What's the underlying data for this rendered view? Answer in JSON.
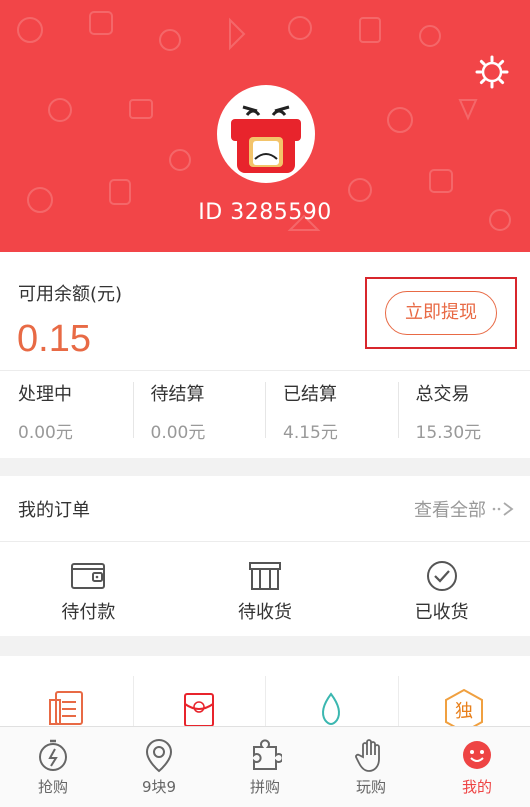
{
  "header": {
    "user_id": "ID 3285590"
  },
  "balance": {
    "label": "可用余额(元)",
    "value": "0.15",
    "withdraw_label": "立即提现"
  },
  "stats": [
    {
      "label": "处理中",
      "value": "0.00元"
    },
    {
      "label": "待结算",
      "value": "0.00元"
    },
    {
      "label": "已结算",
      "value": "4.15元"
    },
    {
      "label": "总交易",
      "value": "15.30元"
    }
  ],
  "orders": {
    "title": "我的订单",
    "view_all": "查看全部",
    "items": [
      {
        "label": "待付款",
        "icon": "wallet-icon"
      },
      {
        "label": "待收货",
        "icon": "package-icon"
      },
      {
        "label": "已收货",
        "icon": "check-circle-icon"
      }
    ]
  },
  "tools": [
    {
      "icon": "document-list-icon"
    },
    {
      "icon": "red-envelope-icon"
    },
    {
      "icon": "teardrop-icon"
    },
    {
      "icon": "exclusive-badge-icon",
      "text": "独"
    }
  ],
  "tabbar": [
    {
      "label": "抢购",
      "icon": "stopwatch-icon"
    },
    {
      "label": "9块9",
      "icon": "location-pin-icon"
    },
    {
      "label": "拼购",
      "icon": "puzzle-icon"
    },
    {
      "label": "玩购",
      "icon": "hand-icon"
    },
    {
      "label": "我的",
      "icon": "smiley-icon",
      "active": true
    }
  ],
  "colors": {
    "header_bg": "#f24548",
    "accent": "#e86a45",
    "highlight_border": "#d8262c"
  }
}
